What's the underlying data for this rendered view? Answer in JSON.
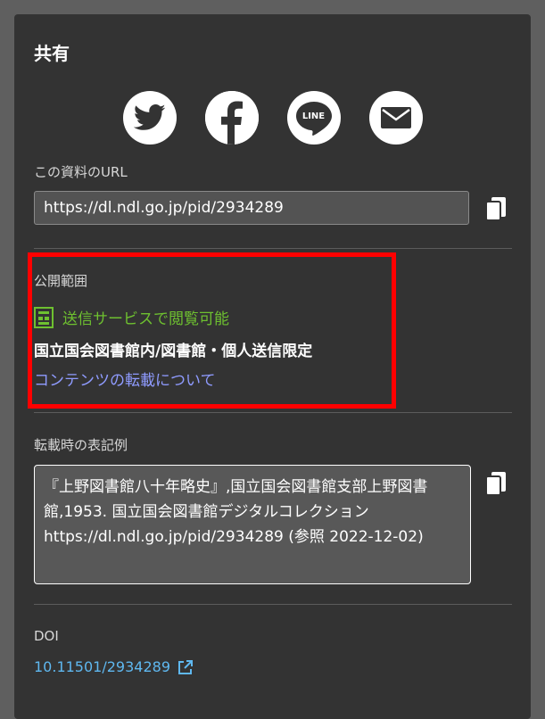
{
  "share": {
    "title": "共有",
    "buttons": [
      {
        "icon": "twitter-icon",
        "label": ""
      },
      {
        "icon": "facebook-icon",
        "label": ""
      },
      {
        "icon": "line-icon",
        "label": "LINE"
      },
      {
        "icon": "mail-icon",
        "label": ""
      }
    ]
  },
  "url": {
    "label": "この資料のURL",
    "value": "https://dl.ndl.go.jp/pid/2934289"
  },
  "publication": {
    "label": "公開範囲",
    "status": "送信サービスで閲覧可能",
    "restriction": "国立国会図書館内/図書館・個人送信限定",
    "reprint_link": "コンテンツの転載について"
  },
  "citation": {
    "label": "転載時の表記例",
    "text": "『上野図書館八十年略史』,国立国会図書館支部上野図書館,1953. 国立国会図書館デジタルコレクション https://dl.ndl.go.jp/pid/2934289 (参照 2022-12-02)"
  },
  "doi": {
    "label": "DOI",
    "value": "10.11501/2934289"
  },
  "colors": {
    "panel": "#333333",
    "status_green": "#6ec030",
    "link": "#8f9bff",
    "doi_link": "#5fb8f0",
    "highlight": "#ff0000"
  }
}
